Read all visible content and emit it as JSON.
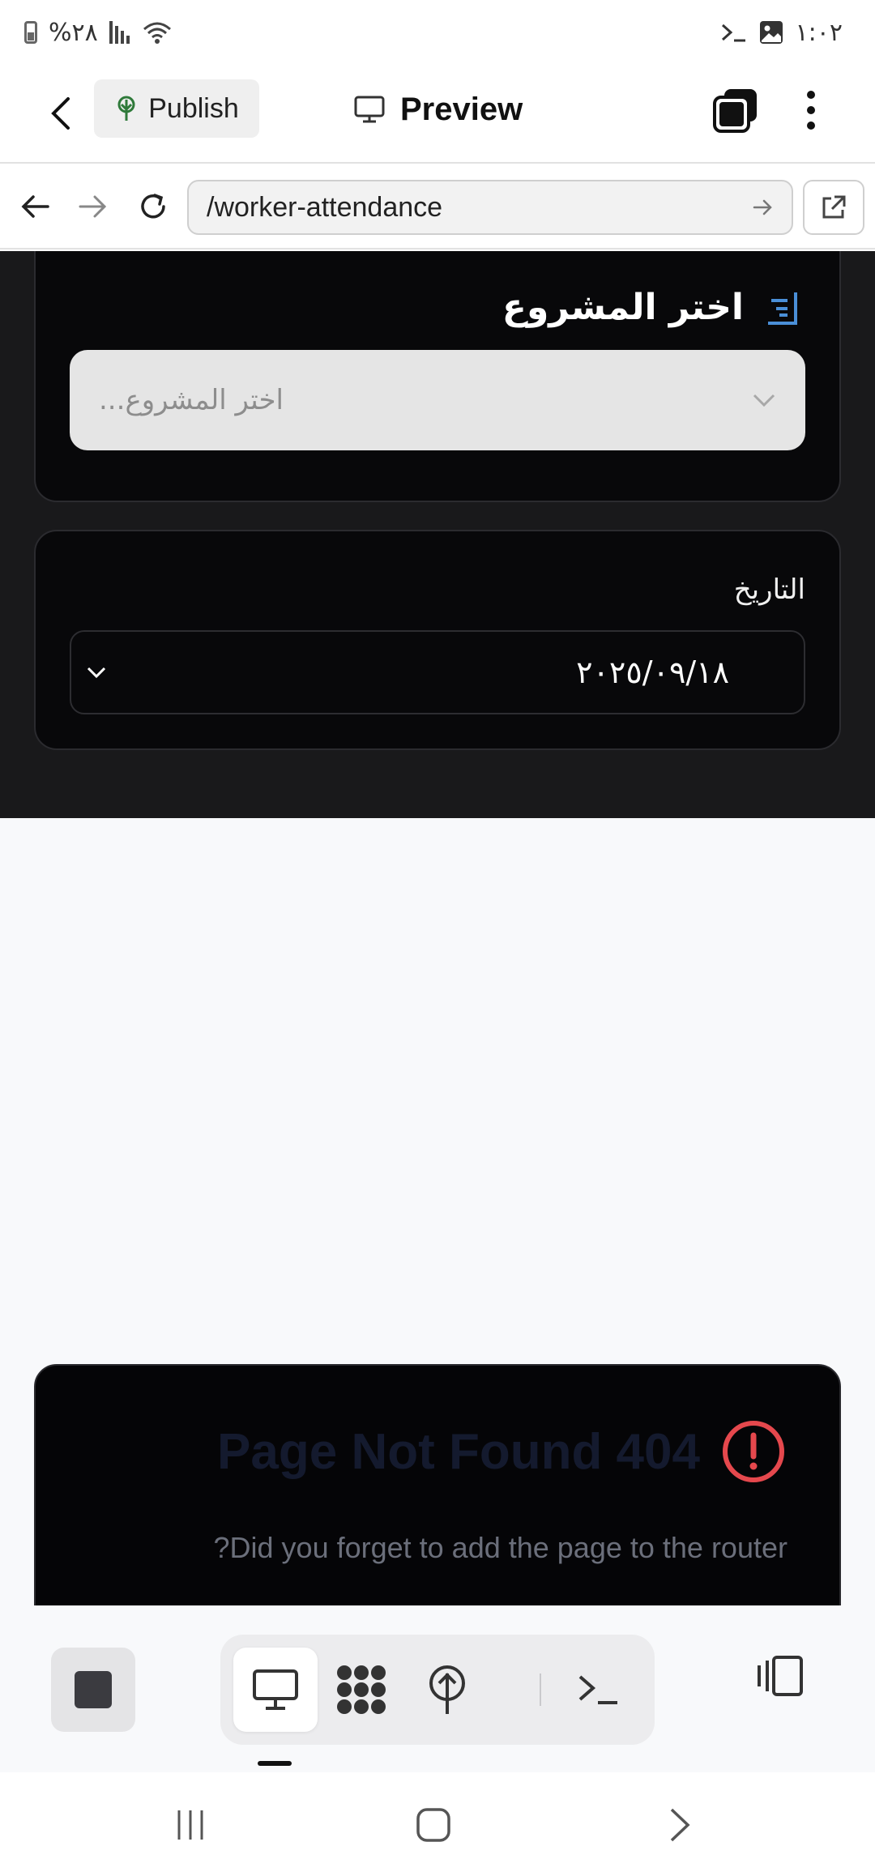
{
  "status_bar": {
    "battery_text": "%٢٨",
    "time": "١:٠٢"
  },
  "header": {
    "publish_label": "Publish",
    "preview_label": "Preview"
  },
  "url_bar": {
    "value": "/worker-attendance"
  },
  "project_card": {
    "title": "اختر المشروع",
    "select_placeholder": "...اختر المشروع"
  },
  "date_card": {
    "label": "التاريخ",
    "value": "٢٠٢٥/٠٩/١٨"
  },
  "not_found": {
    "title": "Page Not Found 404",
    "subtitle": "?Did you forget to add the page to the router",
    "alert_color": "#e5484d"
  },
  "colors": {
    "dark_bg": "#19191b",
    "card_bg": "#08080a",
    "accent_blue": "#4a8fd8",
    "publish_icon_green": "#2f7a3a"
  }
}
